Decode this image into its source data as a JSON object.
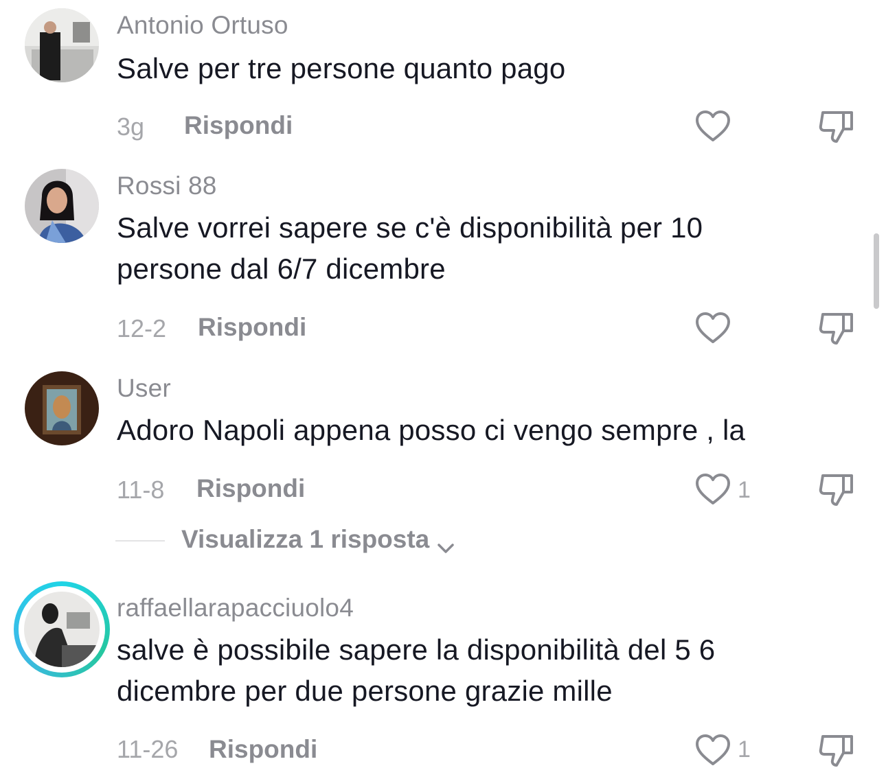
{
  "comments": [
    {
      "username": "Antonio Ortuso",
      "text": "Salve per tre persone quanto pago",
      "date": "3g",
      "reply_label": "Rispondi",
      "likes": ""
    },
    {
      "username": "Rossi 88",
      "text": "Salve vorrei sapere se c'è disponibilità per 10 persone dal 6/7 dicembre",
      "date": "12-2",
      "reply_label": "Rispondi",
      "likes": ""
    },
    {
      "username": "User",
      "text": "Adoro Napoli appena posso ci vengo sempre , la",
      "date": "11-8",
      "reply_label": "Rispondi",
      "likes": "1",
      "view_replies": "Visualizza 1 risposta"
    },
    {
      "username": "raffaellarapacciuolo4",
      "text": "salve è possibile sapere la disponibilità del 5 6 dicembre per due persone grazie mille",
      "date": "11-26",
      "reply_label": "Rispondi",
      "likes": "1"
    }
  ],
  "icons": {
    "like": "heart-outline-icon",
    "dislike": "thumbs-down-icon",
    "expand": "chevron-down-icon"
  },
  "colors": {
    "text_primary": "#161823",
    "text_secondary": "#8a8b91",
    "story_ring": "#1fd4e6"
  }
}
